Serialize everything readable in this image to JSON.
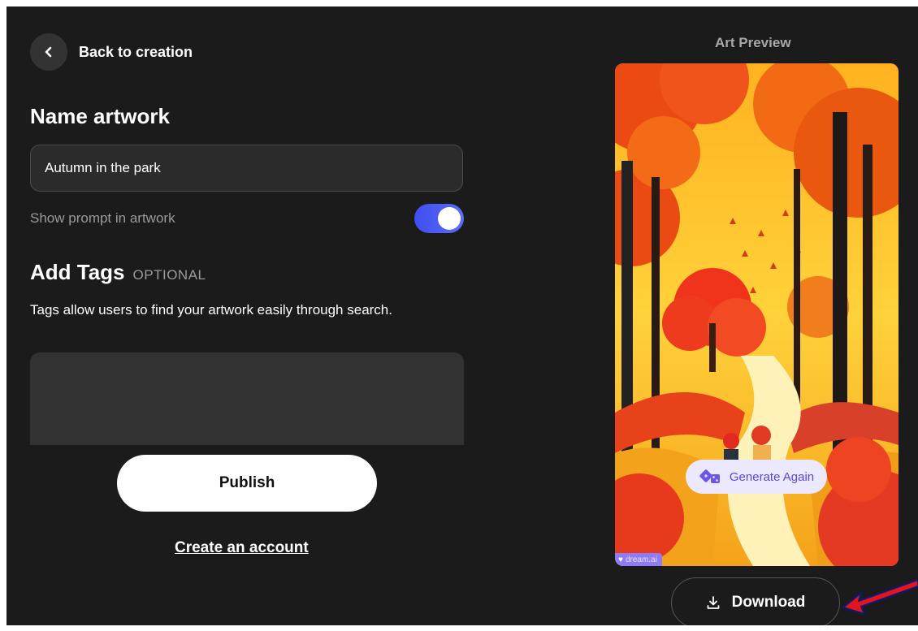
{
  "nav": {
    "back_label": "Back to creation"
  },
  "form": {
    "name_title": "Name artwork",
    "name_value": "Autumn in the park",
    "show_prompt_label": "Show prompt in artwork",
    "show_prompt_enabled": true,
    "tags_title": "Add Tags",
    "tags_optional": "OPTIONAL",
    "tags_description": "Tags allow users to find your artwork easily through search.",
    "tags_value": "",
    "publish_label": "Publish",
    "create_account_label": "Create an account"
  },
  "preview": {
    "label": "Art Preview",
    "generate_again_label": "Generate Again",
    "watermark": "dream.ai",
    "download_label": "Download"
  },
  "icons": {
    "back": "chevron-left-icon",
    "generate": "dice-icon",
    "download": "download-icon",
    "annotation": "red-arrow"
  },
  "colors": {
    "background": "#1b1b1b",
    "toggle_accent": "#4a5cf5",
    "generate_bg": "#ece9ff",
    "generate_text": "#5a48d6",
    "arrow": "#e3141c"
  }
}
